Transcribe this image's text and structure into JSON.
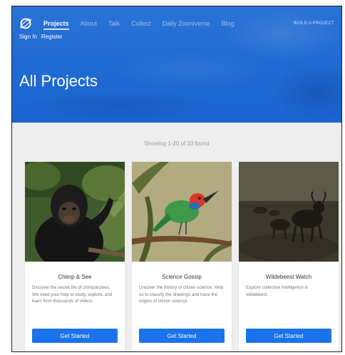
{
  "header": {
    "nav": [
      "Projects",
      "About",
      "Talk",
      "Collect",
      "Daily Zooniverse",
      "Blog"
    ],
    "build_link": "BUILD A PROJECT",
    "sign_in": "Sign In",
    "register": "Register",
    "title": "All Projects"
  },
  "main": {
    "count_text": "Showing 1-20 of 33 found",
    "cards": [
      {
        "title": "Chimp & See",
        "desc": "Discover the secret life of chimpanzees. We need your help to study, explore, and learn from thousands of videos.",
        "button": "Get Started",
        "image": "chimpanzee-photo"
      },
      {
        "title": "Science Gossip",
        "desc": "Uncover the history of citizen science. Help us to classify the drawings and trace the origins of citizen science.",
        "button": "Get Started",
        "image": "bird-illustration"
      },
      {
        "title": "Wildebeest Watch",
        "desc": "Explore collective intelligence in wildebeest.",
        "button": "Get Started",
        "image": "wildebeest-photo"
      }
    ]
  },
  "colors": {
    "hero_blue": "#1f6ad3",
    "button_blue": "#1a73e8",
    "page_bg": "#eeeeee"
  }
}
